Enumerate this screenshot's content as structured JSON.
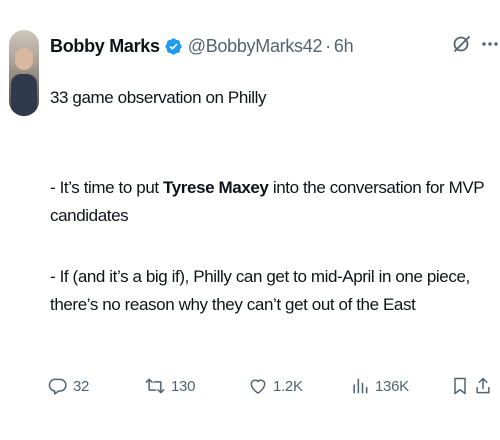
{
  "tweet": {
    "display_name": "Bobby Marks",
    "handle": "@BobbyMarks42",
    "separator": "·",
    "time": "6h",
    "line1": "33 game observation on Philly",
    "line2_prefix": "- It’s time to put ",
    "line2_bold": "Tyrese Maxey",
    "line2_suffix": " into the conversation for MVP candidates",
    "line3": "- If (and it’s a big if), Philly can get to mid-April in one piece, there’s no reason why they can’t get out of the East"
  },
  "stats": {
    "replies": "32",
    "reposts": "130",
    "likes": "1.2K",
    "views": "136K"
  },
  "colors": {
    "text": "#0f1419",
    "muted": "#536471",
    "verified": "#1d9bf0"
  },
  "icons": [
    "verified-badge-icon",
    "grok-icon",
    "more-icon",
    "reply-icon",
    "repost-icon",
    "like-icon",
    "views-icon",
    "bookmark-icon",
    "share-icon"
  ]
}
